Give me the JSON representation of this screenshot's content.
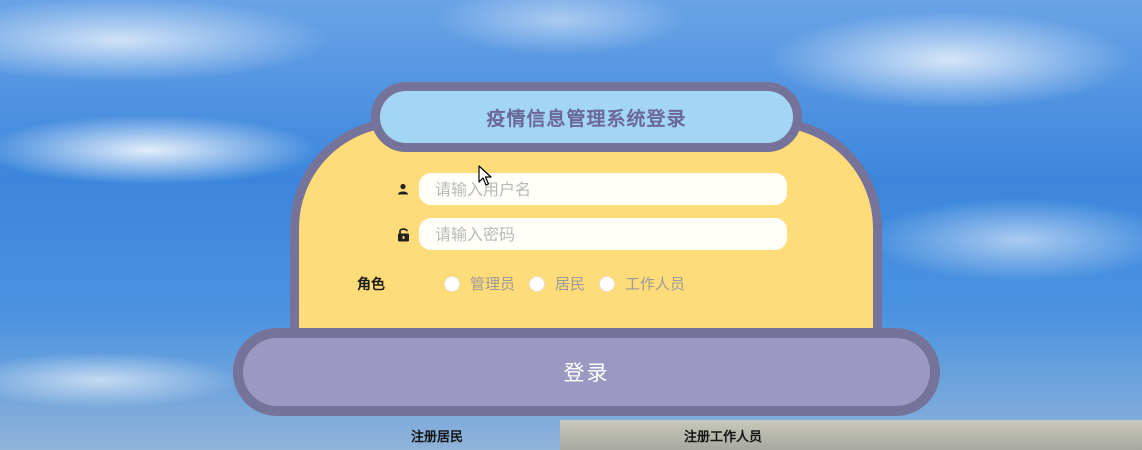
{
  "login_form": {
    "title": "疫情信息管理系统登录",
    "username": {
      "value": "",
      "placeholder": "请输入用户名",
      "icon": "user-icon"
    },
    "password": {
      "value": "",
      "placeholder": "请输入密码",
      "icon": "lock-icon"
    },
    "role_label": "角色",
    "roles": [
      {
        "label": "管理员",
        "selected": false
      },
      {
        "label": "居民",
        "selected": false
      },
      {
        "label": "工作人员",
        "selected": false
      }
    ],
    "login_button": "登录"
  },
  "links": {
    "register_resident": "注册居民",
    "register_staff": "注册工作人员"
  },
  "colors": {
    "panel_fill": "#ffdc7a",
    "panel_border": "#76739b",
    "title_fill": "#a3d6f5",
    "button_fill": "#9b99c1"
  }
}
